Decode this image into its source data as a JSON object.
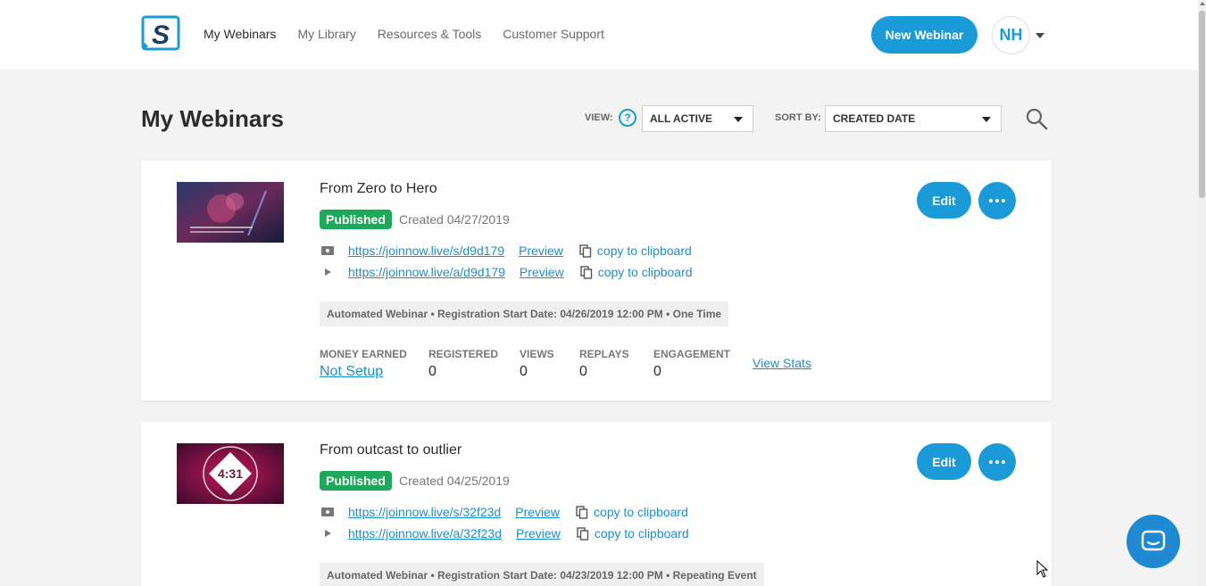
{
  "nav": {
    "items": [
      "My Webinars",
      "My Library",
      "Resources & Tools",
      "Customer Support"
    ],
    "new_button": "New Webinar",
    "avatar_initials": "NH"
  },
  "header": {
    "title": "My Webinars",
    "view_label": "VIEW:",
    "view_value": "ALL ACTIVE",
    "sort_label": "SORT BY:",
    "sort_value": "CREATED DATE"
  },
  "webinars": [
    {
      "title": "From Zero to Hero",
      "status": "Published",
      "created": "Created 04/27/2019",
      "links": [
        {
          "url": "https://joinnow.live/s/d9d179",
          "preview": "Preview",
          "copy": "copy to clipboard"
        },
        {
          "url": "https://joinnow.live/a/d9d179",
          "preview": "Preview",
          "copy": "copy to clipboard"
        }
      ],
      "info": "Automated Webinar • Registration Start Date: 04/26/2019 12:00 PM • One Time",
      "stats": {
        "money_label": "MONEY EARNED",
        "money_value": "Not Setup",
        "registered_label": "REGISTERED",
        "registered_value": "0",
        "views_label": "VIEWS",
        "views_value": "0",
        "replays_label": "REPLAYS",
        "replays_value": "0",
        "engagement_label": "ENGAGEMENT",
        "engagement_value": "0",
        "view_stats": "View Stats"
      },
      "edit": "Edit"
    },
    {
      "title": "From outcast to outlier",
      "status": "Published",
      "created": "Created 04/25/2019",
      "thumb_text": "4:31",
      "links": [
        {
          "url": "https://joinnow.live/s/32f23d",
          "preview": "Preview",
          "copy": "copy to clipboard"
        },
        {
          "url": "https://joinnow.live/a/32f23d",
          "preview": "Preview",
          "copy": "copy to clipboard"
        }
      ],
      "info": "Automated Webinar • Registration Start Date: 04/23/2019 12:00 PM • Repeating Event",
      "edit": "Edit"
    }
  ],
  "colors": {
    "accent": "#1a9bd7",
    "published": "#1ea85a",
    "link": "#1a8fcc"
  }
}
